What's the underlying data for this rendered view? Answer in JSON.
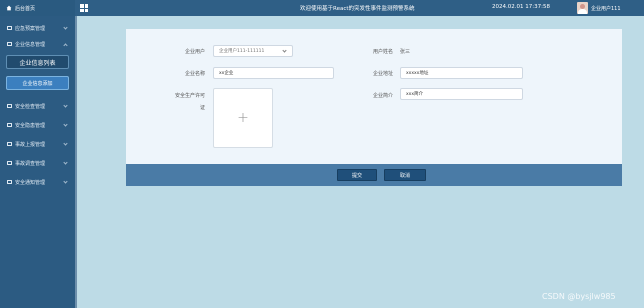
{
  "topbar": {
    "brand": "后台首页",
    "title": "欢迎使用基于React的突发性事件监测预警系统",
    "datetime": "2024.02.01 17:37:58",
    "username": "企业用户111"
  },
  "sidebar": {
    "items_top": [
      {
        "label": "应急预案管理"
      },
      {
        "label": "企业信息管理"
      }
    ],
    "sub_items": [
      {
        "label": "企业信息列表"
      },
      {
        "label": "企业信息添加"
      }
    ],
    "items_bottom": [
      {
        "label": "安全检查管理"
      },
      {
        "label": "安全隐患管理"
      },
      {
        "label": "事故上报管理"
      },
      {
        "label": "事故调查管理"
      },
      {
        "label": "安全通知管理"
      }
    ]
  },
  "form": {
    "company_user_label": "企业用户",
    "company_user_value": "企业用户111-111111",
    "user_name_label": "用户姓名",
    "user_name_value": "张三",
    "company_name_label": "企业名称",
    "company_name_value": "xx企业",
    "company_address_label": "企业地址",
    "company_address_value": "xxxxx地址",
    "safety_license_label_1": "安全生产许可",
    "safety_license_label_2": "证",
    "upload_symbol": "+",
    "company_intro_label": "企业简介",
    "company_intro_value": "xxx简介"
  },
  "actions": {
    "submit": "提交",
    "cancel": "取消"
  },
  "watermark": "CSDN @bysjlw985"
}
